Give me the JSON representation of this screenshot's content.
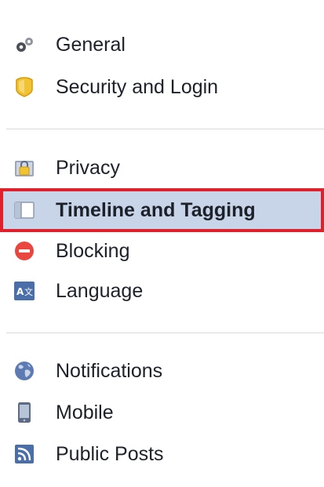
{
  "settings_nav": {
    "groups": [
      {
        "items": [
          {
            "label": "General",
            "icon": "gears-icon"
          },
          {
            "label": "Security and Login",
            "icon": "shield-icon"
          }
        ]
      },
      {
        "items": [
          {
            "label": "Privacy",
            "icon": "privacy-lock-icon"
          },
          {
            "label": "Timeline and Tagging",
            "icon": "timeline-icon",
            "selected": true
          },
          {
            "label": "Blocking",
            "icon": "blocking-icon"
          },
          {
            "label": "Language",
            "icon": "language-icon"
          }
        ]
      },
      {
        "items": [
          {
            "label": "Notifications",
            "icon": "globe-icon"
          },
          {
            "label": "Mobile",
            "icon": "mobile-phone-icon"
          },
          {
            "label": "Public Posts",
            "icon": "rss-feed-icon"
          }
        ]
      }
    ]
  },
  "colors": {
    "selected_background": "#c8d4e8",
    "selected_border": "#e0202a",
    "divider": "#d7d9dd",
    "text": "#1d2129"
  }
}
